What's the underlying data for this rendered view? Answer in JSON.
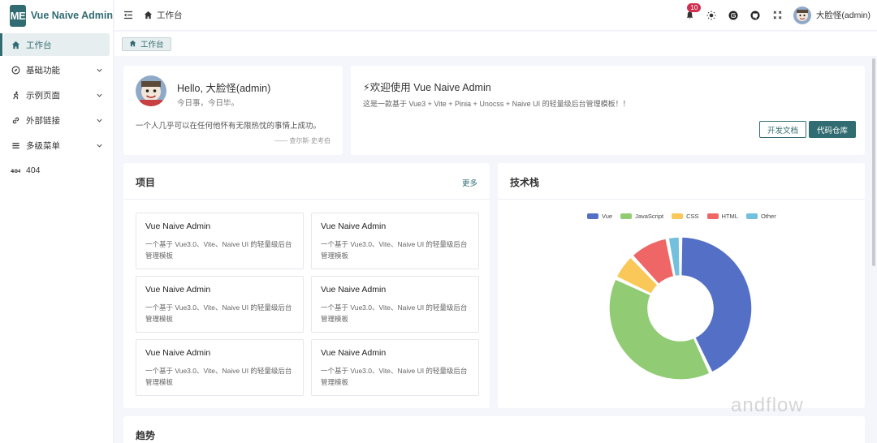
{
  "app": {
    "logo_text": "ME",
    "title": "Vue Naive Admin",
    "brand_color": "#316c72"
  },
  "sidebar": {
    "items": [
      {
        "label": "工作台",
        "icon": "home-icon",
        "active": true
      },
      {
        "label": "基础功能",
        "icon": "compass-icon"
      },
      {
        "label": "示例页面",
        "icon": "figure-icon"
      },
      {
        "label": "外部链接",
        "icon": "link-icon"
      },
      {
        "label": "多级菜单",
        "icon": "list-icon"
      },
      {
        "label": "404",
        "icon": "404-icon"
      }
    ]
  },
  "header": {
    "breadcrumb": "工作台",
    "notification_count": "10",
    "user_name": "大脸怪(admin)"
  },
  "tabs": [
    {
      "label": "工作台"
    }
  ],
  "hello": {
    "title": "Hello, 大脸怪(admin)",
    "subtitle": "今日事，今日毕。",
    "quote": "一个人几乎可以在任何他怀有无限热忱的事情上成功。",
    "author": "—— 查尔斯·史考伯"
  },
  "welcome": {
    "title": "⚡欢迎使用 Vue Naive Admin",
    "description": "这是一款基于 Vue3 + Vite + Pinia + Unocss + Naive UI 的轻量级后台管理模板！！",
    "docs_button": "开发文档",
    "repo_button": "代码仓库"
  },
  "projects": {
    "title": "项目",
    "more": "更多",
    "items": [
      {
        "title": "Vue Naive Admin",
        "desc": "一个基于 Vue3.0、Vite、Naive UI 的轻量级后台管理模板"
      },
      {
        "title": "Vue Naive Admin",
        "desc": "一个基于 Vue3.0、Vite、Naive UI 的轻量级后台管理模板"
      },
      {
        "title": "Vue Naive Admin",
        "desc": "一个基于 Vue3.0、Vite、Naive UI 的轻量级后台管理模板"
      },
      {
        "title": "Vue Naive Admin",
        "desc": "一个基于 Vue3.0、Vite、Naive UI 的轻量级后台管理模板"
      },
      {
        "title": "Vue Naive Admin",
        "desc": "一个基于 Vue3.0、Vite、Naive UI 的轻量级后台管理模板"
      },
      {
        "title": "Vue Naive Admin",
        "desc": "一个基于 Vue3.0、Vite、Naive UI 的轻量级后台管理模板"
      }
    ]
  },
  "tech": {
    "title": "技术栈"
  },
  "chart_data": {
    "type": "pie",
    "title": "",
    "categories": [
      "Vue",
      "JavaScript",
      "CSS",
      "HTML",
      "Other"
    ],
    "values": [
      43,
      39,
      6,
      9,
      3
    ],
    "colors": [
      "#5470c6",
      "#91cc75",
      "#fac858",
      "#ee6666",
      "#73c0de"
    ],
    "legend_position": "top"
  },
  "trend": {
    "title": "趋势"
  },
  "watermark": "andflow"
}
